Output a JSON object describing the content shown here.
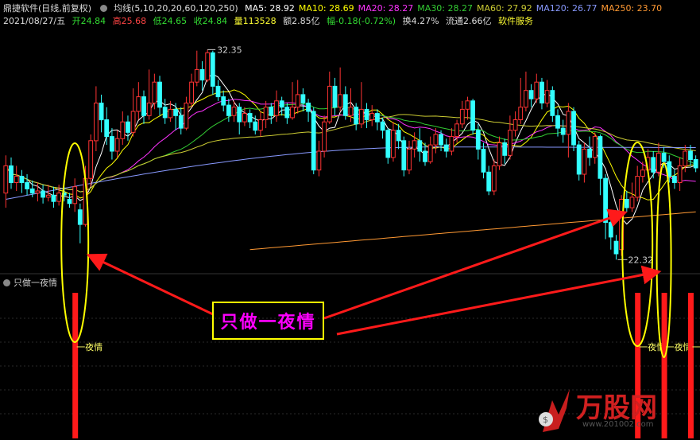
{
  "header": {
    "stock_name": "鼎捷软件(日线,前复权)",
    "ma_label": "均线(5,10,20,20,60,120,250)",
    "ma_values": [
      {
        "label": "MA5: 28.92",
        "color": "#ffffff"
      },
      {
        "label": "MA10: 28.69",
        "color": "#ffff00"
      },
      {
        "label": "MA20: 28.27",
        "color": "#ff33ff"
      },
      {
        "label": "MA30: 28.27",
        "color": "#33cc33"
      },
      {
        "label": "MA60: 27.92",
        "color": "#cccc33"
      },
      {
        "label": "MA120: 26.77",
        "color": "#8899ff"
      },
      {
        "label": "MA250: 23.70",
        "color": "#ff9933"
      }
    ],
    "date": "2021/08/27/五",
    "open": "开24.84",
    "high": "高25.68",
    "low": "低24.65",
    "close": "收24.84",
    "volume": "量113528",
    "amount": "额2.85亿",
    "change": "幅-0.18(-0.72%)",
    "turnover": "换4.27%",
    "float_cap": "流通2.66亿",
    "sector": "软件服务"
  },
  "indicator": {
    "title": "只做一夜情",
    "signal_label": "一夜情",
    "callout_text": "只做一夜情"
  },
  "watermark": {
    "brand": "万股网",
    "url": "www.201002.com"
  },
  "chart_data": {
    "type": "candlestick",
    "title": "鼎捷软件(日线,前复权)",
    "price_range": [
      21.8,
      33.2
    ],
    "annotations": [
      {
        "text": "32.35",
        "type": "max"
      },
      {
        "text": "22.32",
        "type": "min"
      }
    ],
    "colors": {
      "up": "#ff3333",
      "down": "#33ffff"
    },
    "candles": [
      [
        25.5,
        26.8,
        27.3,
        24.8
      ],
      [
        26.8,
        26.0,
        27.2,
        25.7
      ],
      [
        26.0,
        26.3,
        26.8,
        25.6
      ],
      [
        26.3,
        26.0,
        26.6,
        25.5
      ],
      [
        26.0,
        25.7,
        26.4,
        25.4
      ],
      [
        25.7,
        25.5,
        26.1,
        25.3
      ],
      [
        25.5,
        25.6,
        26.0,
        25.1
      ],
      [
        25.6,
        25.3,
        25.9,
        25.0
      ],
      [
        25.3,
        25.4,
        25.9,
        25.1
      ],
      [
        25.4,
        25.1,
        25.8,
        24.8
      ],
      [
        25.1,
        25.5,
        25.9,
        24.9
      ],
      [
        25.5,
        25.4,
        25.8,
        25.1
      ],
      [
        25.2,
        25.0,
        25.5,
        24.8
      ],
      [
        25.0,
        25.8,
        26.2,
        24.6
      ],
      [
        24.7,
        24.0,
        25.0,
        23.1
      ],
      [
        24.0,
        26.2,
        26.8,
        23.9
      ],
      [
        26.2,
        28.0,
        28.3,
        25.8
      ],
      [
        28.0,
        29.8,
        30.6,
        27.5
      ],
      [
        29.8,
        29.0,
        30.2,
        28.4
      ],
      [
        29.0,
        28.2,
        29.6,
        27.8
      ],
      [
        28.2,
        27.5,
        28.6,
        27.1
      ],
      [
        27.5,
        28.1,
        28.5,
        27.2
      ],
      [
        28.1,
        28.9,
        29.4,
        27.8
      ],
      [
        28.9,
        28.4,
        29.2,
        28.0
      ],
      [
        28.4,
        29.4,
        30.5,
        28.2
      ],
      [
        29.4,
        30.1,
        30.8,
        29.0
      ],
      [
        30.1,
        29.2,
        30.4,
        28.8
      ],
      [
        29.2,
        29.8,
        31.4,
        29.0
      ],
      [
        29.8,
        30.8,
        31.2,
        29.5
      ],
      [
        30.8,
        29.6,
        31.1,
        29.2
      ],
      [
        29.6,
        29.1,
        30.0,
        28.8
      ],
      [
        29.1,
        29.5,
        29.9,
        28.9
      ],
      [
        29.5,
        29.2,
        29.8,
        28.5
      ],
      [
        29.2,
        28.6,
        29.6,
        28.3
      ],
      [
        28.6,
        29.8,
        30.1,
        28.5
      ],
      [
        29.8,
        30.8,
        31.2,
        29.6
      ],
      [
        30.8,
        31.4,
        32.3,
        30.6
      ],
      [
        31.4,
        30.9,
        31.8,
        30.4
      ],
      [
        30.9,
        32.2,
        32.35,
        30.8
      ],
      [
        32.2,
        30.6,
        32.3,
        30.2
      ],
      [
        30.6,
        30.1,
        30.9,
        29.9
      ],
      [
        30.1,
        29.7,
        30.4,
        29.4
      ],
      [
        29.7,
        29.2,
        30.0,
        28.9
      ],
      [
        29.2,
        29.6,
        29.9,
        28.9
      ],
      [
        29.6,
        28.9,
        29.8,
        28.3
      ],
      [
        28.9,
        29.3,
        29.6,
        28.7
      ],
      [
        29.3,
        28.9,
        29.5,
        28.6
      ],
      [
        28.9,
        28.5,
        29.2,
        28.3
      ],
      [
        28.5,
        29.0,
        29.4,
        28.2
      ],
      [
        29.0,
        29.6,
        29.9,
        28.6
      ],
      [
        29.6,
        29.2,
        29.8,
        28.8
      ],
      [
        29.2,
        29.9,
        30.4,
        28.9
      ],
      [
        29.9,
        29.6,
        30.1,
        29.2
      ],
      [
        29.6,
        29.1,
        29.8,
        28.8
      ],
      [
        29.1,
        29.6,
        30.8,
        29.0
      ],
      [
        29.6,
        30.2,
        30.9,
        29.3
      ],
      [
        30.2,
        29.8,
        30.5,
        29.4
      ],
      [
        29.8,
        29.4,
        30.0,
        28.9
      ],
      [
        29.4,
        26.6,
        29.6,
        26.4
      ],
      [
        26.6,
        27.5,
        28.0,
        26.3
      ],
      [
        27.5,
        28.9,
        29.2,
        27.2
      ],
      [
        28.9,
        30.6,
        31.3,
        28.8
      ],
      [
        30.6,
        29.6,
        31.0,
        29.2
      ],
      [
        29.6,
        30.2,
        31.5,
        29.4
      ],
      [
        30.2,
        29.2,
        30.6,
        29.0
      ],
      [
        29.2,
        29.6,
        30.5,
        28.9
      ],
      [
        29.6,
        28.8,
        29.8,
        28.5
      ],
      [
        28.8,
        29.5,
        30.8,
        28.6
      ],
      [
        29.5,
        29.0,
        29.8,
        28.6
      ],
      [
        29.0,
        29.3,
        29.7,
        28.7
      ],
      [
        29.3,
        28.9,
        29.5,
        28.5
      ],
      [
        28.9,
        28.5,
        29.1,
        28.1
      ],
      [
        28.5,
        27.2,
        28.6,
        26.9
      ],
      [
        27.2,
        28.5,
        28.9,
        27.0
      ],
      [
        28.5,
        28.0,
        28.8,
        27.6
      ],
      [
        28.0,
        26.6,
        28.2,
        26.3
      ],
      [
        26.6,
        27.6,
        28.0,
        26.4
      ],
      [
        27.6,
        28.0,
        28.4,
        27.2
      ],
      [
        28.0,
        27.5,
        28.6,
        27.0
      ],
      [
        27.5,
        27.0,
        27.9,
        26.8
      ],
      [
        27.0,
        27.8,
        28.2,
        26.9
      ],
      [
        27.8,
        28.3,
        28.6,
        27.4
      ],
      [
        28.3,
        27.8,
        28.5,
        27.5
      ],
      [
        27.8,
        27.5,
        28.1,
        27.2
      ],
      [
        27.5,
        28.2,
        28.6,
        27.3
      ],
      [
        28.2,
        28.8,
        29.0,
        27.9
      ],
      [
        28.8,
        29.5,
        29.9,
        28.6
      ],
      [
        29.5,
        29.9,
        30.1,
        29.0
      ],
      [
        29.9,
        28.5,
        30.0,
        28.3
      ],
      [
        28.5,
        27.6,
        28.8,
        27.1
      ],
      [
        27.6,
        26.5,
        27.9,
        26.2
      ],
      [
        26.5,
        25.6,
        26.8,
        25.4
      ],
      [
        25.6,
        26.8,
        27.1,
        25.4
      ],
      [
        26.8,
        27.9,
        28.2,
        26.6
      ],
      [
        27.9,
        27.3,
        28.1,
        26.9
      ],
      [
        27.3,
        28.5,
        29.2,
        27.1
      ],
      [
        28.5,
        29.0,
        29.4,
        28.2
      ],
      [
        29.0,
        29.6,
        31.0,
        28.8
      ],
      [
        29.6,
        30.4,
        31.3,
        29.4
      ],
      [
        30.4,
        30.0,
        30.7,
        29.6
      ],
      [
        30.0,
        30.8,
        31.2,
        29.8
      ],
      [
        30.8,
        29.8,
        31.0,
        29.5
      ],
      [
        29.8,
        30.4,
        30.9,
        29.6
      ],
      [
        30.4,
        29.2,
        30.6,
        28.9
      ],
      [
        29.2,
        28.6,
        29.5,
        28.2
      ],
      [
        28.6,
        28.3,
        29.0,
        27.9
      ],
      [
        28.3,
        29.4,
        29.8,
        27.2
      ],
      [
        29.4,
        27.8,
        29.6,
        27.5
      ],
      [
        27.8,
        26.4,
        28.0,
        26.1
      ],
      [
        26.4,
        27.6,
        27.9,
        26.0
      ],
      [
        27.6,
        27.2,
        28.2,
        26.8
      ],
      [
        27.2,
        28.2,
        28.4,
        26.9
      ],
      [
        28.2,
        26.2,
        28.3,
        25.4
      ],
      [
        26.2,
        24.1,
        26.4,
        23.3
      ],
      [
        24.1,
        23.4,
        24.3,
        22.8
      ],
      [
        23.2,
        22.6,
        23.5,
        22.32
      ],
      [
        22.8,
        25.2,
        25.4,
        22.5
      ],
      [
        25.2,
        24.8,
        25.6,
        24.6
      ],
      [
        24.8,
        25.3,
        26.0,
        24.6
      ],
      [
        25.3,
        26.3,
        26.8,
        25.1
      ],
      [
        26.3,
        26.6,
        27.0,
        26.0
      ],
      [
        26.6,
        27.2,
        27.6,
        26.4
      ],
      [
        27.2,
        26.5,
        27.5,
        26.2
      ],
      [
        26.5,
        27.4,
        27.9,
        26.3
      ],
      [
        27.4,
        27.0,
        27.7,
        26.7
      ],
      [
        27.0,
        26.3,
        27.3,
        26.0
      ],
      [
        26.3,
        26.0,
        26.6,
        25.7
      ],
      [
        26.0,
        26.8,
        27.2,
        25.6
      ],
      [
        26.8,
        27.5,
        27.8,
        26.5
      ],
      [
        27.5,
        27.1,
        27.8,
        26.8
      ],
      [
        27.1,
        26.7,
        27.3,
        26.5
      ]
    ],
    "signals": [
      13,
      119,
      124,
      129
    ]
  }
}
